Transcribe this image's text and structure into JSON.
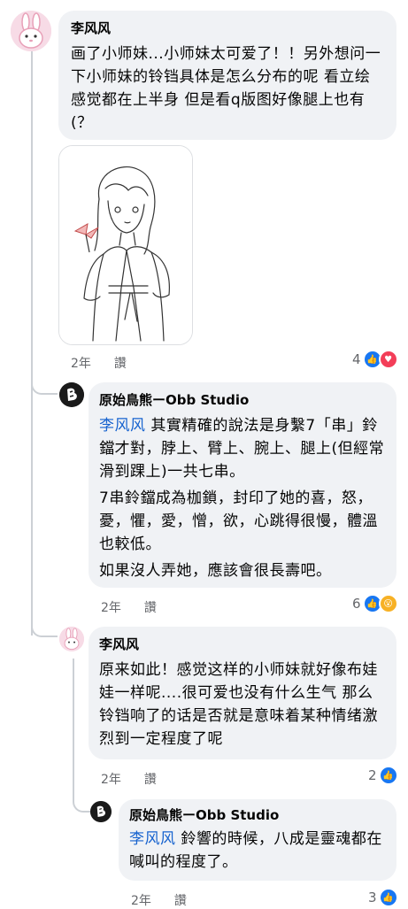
{
  "comments": [
    {
      "author": "李风风",
      "text": "画了小师妹...小师妹太可爱了！！另外想问一下小师妹的铃铛具体是怎么分布的呢 看立绘感觉都在上半身 但是看q版图好像腿上也有(？",
      "time": "2年",
      "like_label": "讚",
      "reaction_count": "4",
      "reactions": [
        "like-icon",
        "love-icon"
      ]
    },
    {
      "author": "原始鳥熊ーObb Studio",
      "mention": "李风风",
      "text_1": " 其實精確的說法是身繫7「串」鈴鐺才對，脖上、臂上、腕上、腿上(但經常滑到踝上)一共七串。",
      "text_2": "7串鈴鐺成為枷鎖，封印了她的喜，怒，憂，懼，愛，憎，欲，心跳得很慢，體溫也較低。",
      "text_3": "如果沒人弄她，應該會很長壽吧。",
      "time": "2年",
      "like_label": "讚",
      "reaction_count": "6",
      "reactions": [
        "like-icon",
        "wow-icon"
      ]
    },
    {
      "author": "李风风",
      "text": "原来如此！感觉这样的小师妹就好像布娃娃一样呢....很可爱也没有什么生气 那么铃铛响了的话是否就是意味着某种情绪激烈到一定程度了呢",
      "time": "2年",
      "like_label": "讚",
      "reaction_count": "2",
      "reactions": [
        "like-icon"
      ]
    },
    {
      "author": "原始鳥熊ーObb Studio",
      "mention": "李风风",
      "text": " 鈴響的時候，八成是靈魂都在喊叫的程度了。",
      "time": "2年",
      "like_label": "讚",
      "reaction_count": "3",
      "reactions": [
        "like-icon"
      ]
    }
  ],
  "colors": {
    "bubble": "#f0f2f5",
    "mention": "#1763cf",
    "meta": "#65676b",
    "like": "#1877f2",
    "love": "#f33e58",
    "wow": "#f7b125"
  }
}
